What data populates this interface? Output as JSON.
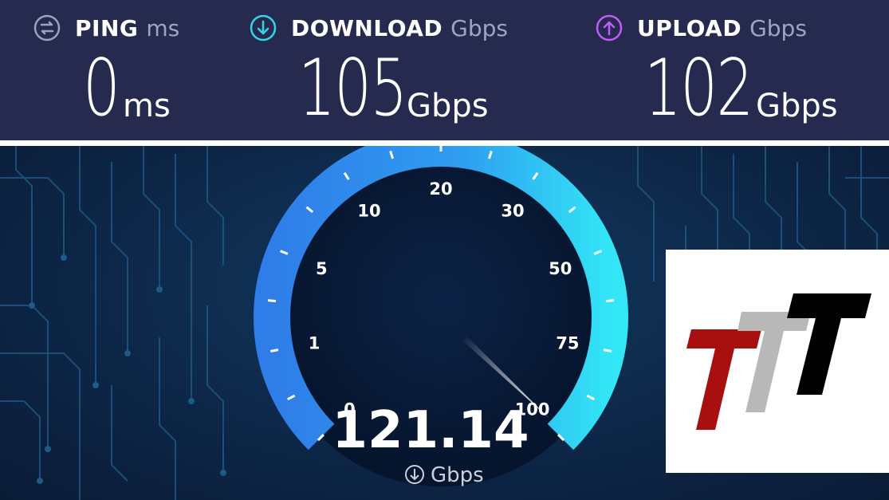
{
  "header": {
    "ping": {
      "label": "PING",
      "unit": "ms",
      "value": "0",
      "value_unit": "ms",
      "icon": "ping-icon",
      "color": "#9aa3bd"
    },
    "download": {
      "label": "DOWNLOAD",
      "unit": "Gbps",
      "value": "105",
      "value_unit": "Gbps",
      "icon": "download-arrow-icon",
      "color": "#33d6e6"
    },
    "upload": {
      "label": "UPLOAD",
      "unit": "Gbps",
      "value": "102",
      "value_unit": "Gbps",
      "icon": "upload-arrow-icon",
      "color": "#c05cff"
    }
  },
  "gauge": {
    "scale_labels": [
      "0",
      "1",
      "5",
      "10",
      "20",
      "30",
      "50",
      "75",
      "100"
    ],
    "current_speed": "121.14",
    "speed_unit": "Gbps",
    "needle_value": "100",
    "arc_colors": [
      "#2f7de8",
      "#32e6f6"
    ]
  },
  "logo": {
    "letters": [
      "T",
      "T",
      "T"
    ],
    "colors": [
      "#a80f0f",
      "#b8b8b8",
      "#000000"
    ]
  }
}
